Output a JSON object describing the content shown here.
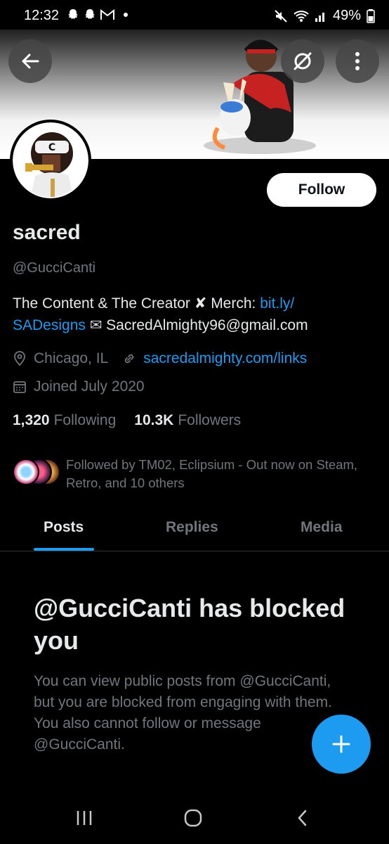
{
  "status_bar": {
    "time": "12:32",
    "battery": "49%"
  },
  "header": {
    "back_icon": "arrow-left-icon",
    "grok_icon": "grok-icon",
    "more_icon": "more-vertical-icon"
  },
  "profile": {
    "name": "sacred",
    "handle": "@GucciCanti",
    "follow_label": "Follow",
    "bio_line1_text": "The Content & The Creator ",
    "bio_emoji_x": "✘",
    "bio_merch": " Merch: ",
    "bio_link": "bit.ly/",
    "bio_link_cont": "SADesigns",
    "bio_email_icon": "✉",
    "bio_email": " SacredAlmighty96@gmail.com",
    "location": "Chicago, IL",
    "website": "sacredalmighty.com/links",
    "joined": "Joined July 2020",
    "following_count": "1,320",
    "following_label": "Following",
    "followers_count": "10.3K",
    "followers_label": "Followers",
    "followed_by": "Followed by TM02, Eclipsium - Out now on Steam, Retro, and 10 others"
  },
  "tabs": [
    {
      "label": "Posts",
      "active": true
    },
    {
      "label": "Replies",
      "active": false
    },
    {
      "label": "Media",
      "active": false
    }
  ],
  "blocked": {
    "title": "@GucciCanti has blocked you",
    "message": "You can view public posts from @GucciCanti, but you are blocked from engaging with them. You also cannot follow or message @GucciCanti."
  },
  "colors": {
    "accent": "#1d9bf0",
    "background": "#000000",
    "text_primary": "#e7e9ea",
    "text_secondary": "#71767b"
  }
}
